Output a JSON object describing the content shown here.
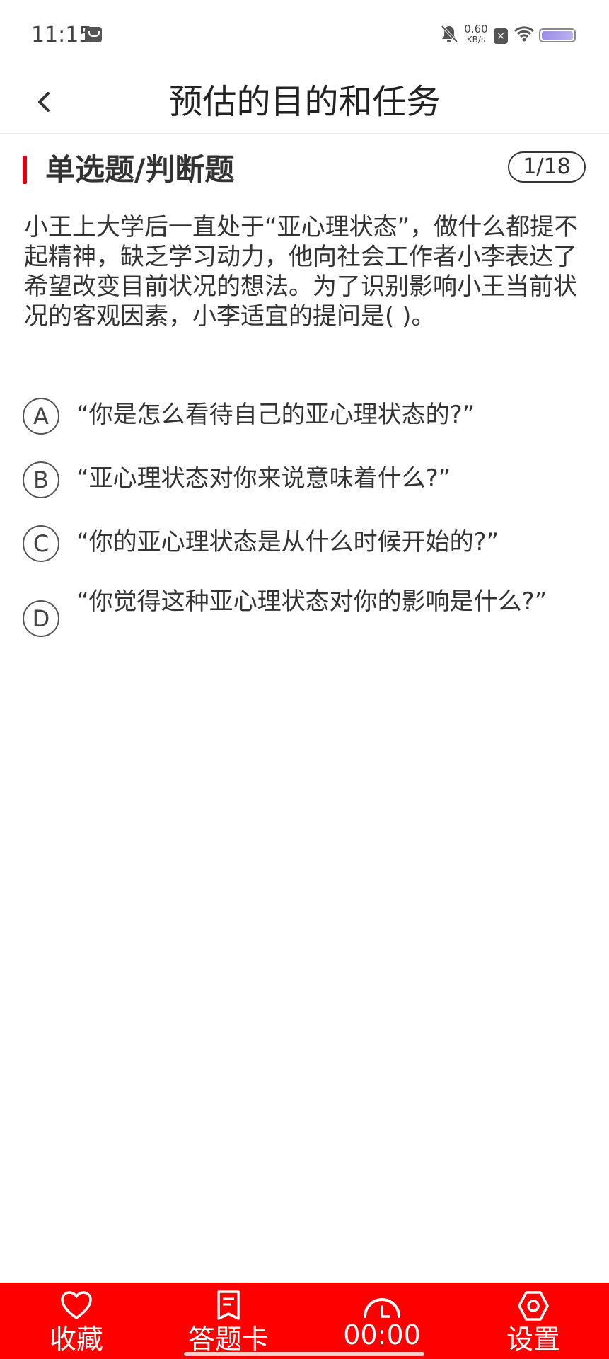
{
  "status_bar": {
    "time": "11:15",
    "net_speed": "0.60",
    "net_unit": "KB/s",
    "sim_label": "×",
    "icons": [
      "message-icon",
      "mute-bell-icon",
      "sim-icon",
      "wifi-icon",
      "battery-icon"
    ],
    "battery_color": "#9b8de8"
  },
  "header": {
    "title": "预估的目的和任务",
    "back_icon": "chevron-left-icon"
  },
  "section": {
    "title": "单选题/判断题",
    "counter": "1/18",
    "accent_color": "#e60012"
  },
  "question": {
    "text": "小王上大学后一直处于“亚心理状态”，做什么都提不起精神，缺乏学习动力，他向社会工作者小李表达了希望改变目前状况的想法。为了识别影响小王当前状况的客观因素，小李适宜的提问是( )。"
  },
  "options": [
    {
      "letter": "A",
      "text": "“你是怎么看待自己的亚心理状态的?”"
    },
    {
      "letter": "B",
      "text": "“亚心理状态对你来说意味着什么?”"
    },
    {
      "letter": "C",
      "text": "“你的亚心理状态是从什么时候开始的?”"
    },
    {
      "letter": "D",
      "text": "“你觉得这种亚心理状态对你的影响是什么?”"
    }
  ],
  "bottom_bar": {
    "background_color": "#ff0000",
    "favorite_label": "收藏",
    "answer_card_label": "答题卡",
    "timer_value": "00:00",
    "settings_label": "设置",
    "icons": [
      "heart-icon",
      "answer-card-icon",
      "timer-gauge-icon",
      "settings-hexagon-icon"
    ]
  }
}
